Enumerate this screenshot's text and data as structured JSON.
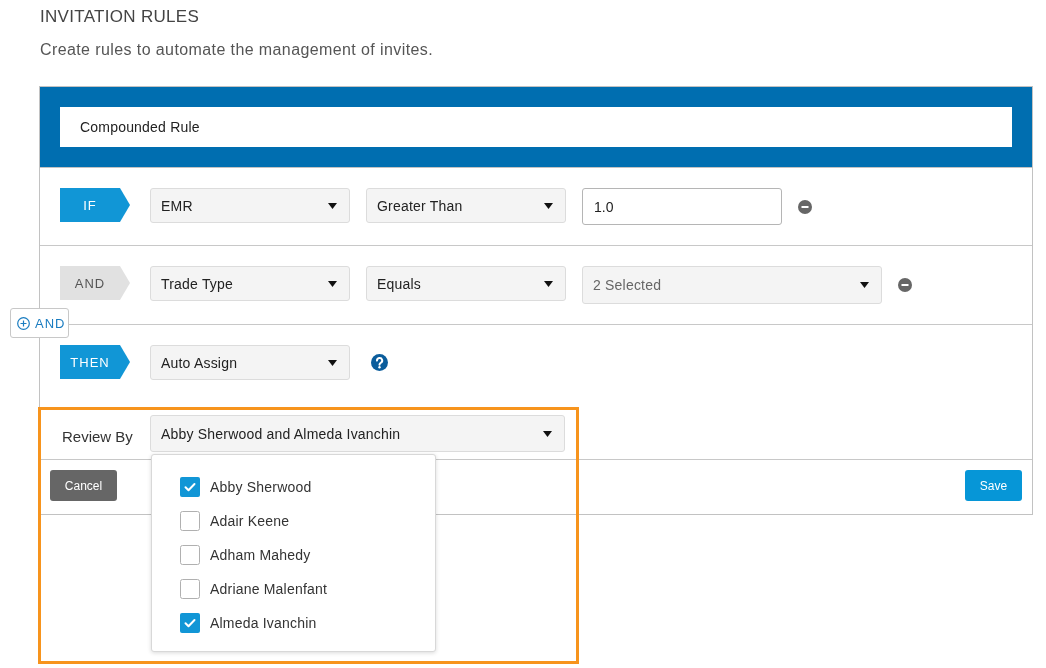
{
  "header": {
    "title": "INVITATION RULES",
    "subtitle": "Create rules to automate the management of invites."
  },
  "rule": {
    "name": "Compounded Rule",
    "conditions": [
      {
        "tag": {
          "label": "IF",
          "highlighted": true
        },
        "field": "EMR",
        "operator": "Greater Than",
        "value": {
          "kind": "input",
          "text": "1.0"
        }
      },
      {
        "tag": {
          "label": "AND",
          "highlighted": false
        },
        "field": "Trade Type",
        "operator": "Equals",
        "value": {
          "kind": "multiselect",
          "text": "2 Selected"
        }
      }
    ],
    "add_button": {
      "label": "AND"
    },
    "action": {
      "tag": {
        "label": "THEN",
        "highlighted": true
      },
      "value": "Auto Assign"
    }
  },
  "review": {
    "label": "Review By",
    "value": "Abby Sherwood and Almeda Ivanchin",
    "expanded": true,
    "options": [
      {
        "name": "Abby Sherwood",
        "checked": true
      },
      {
        "name": "Adair Keene",
        "checked": false
      },
      {
        "name": "Adham Mahedy",
        "checked": false
      },
      {
        "name": "Adriane Malenfant",
        "checked": false
      },
      {
        "name": "Almeda Ivanchin",
        "checked": true
      }
    ]
  },
  "buttons": [
    {
      "label": "Cancel",
      "kind": "secondary"
    },
    {
      "label": "Save",
      "kind": "primary"
    }
  ]
}
